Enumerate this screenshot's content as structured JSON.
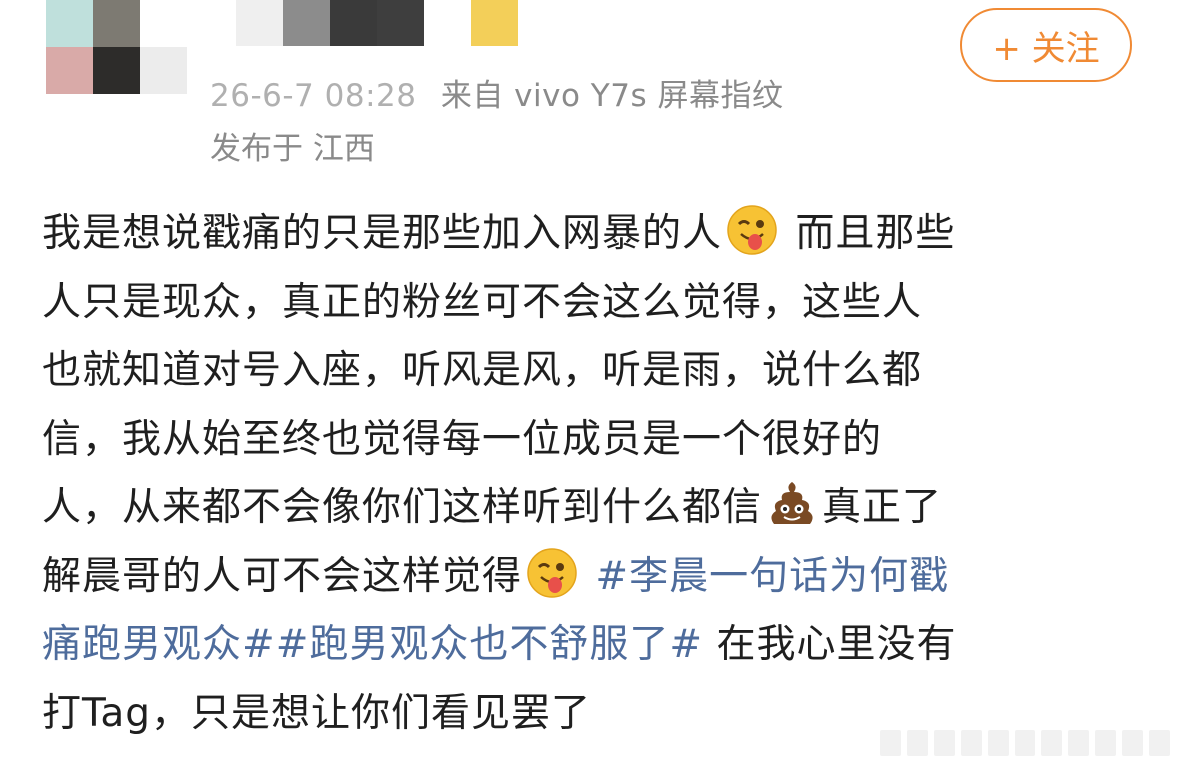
{
  "colors": {
    "follow_accent": "#f08a34",
    "hashtag": "#4e6c9c",
    "meta_text": "#8a8a8a",
    "body_text": "#1f1f1f"
  },
  "header": {
    "follow_label": "+ 关注",
    "date": "26-6-7 08:28",
    "source": "来自 vivo Y7s 屏幕指纹",
    "location": "发布于 江西"
  },
  "post": {
    "line1a": "我是想说戳痛的只是那些加入网暴的人",
    "line1b": "而且那些",
    "line2": "人只是现众，真正的粉丝可不会这么觉得，这些人",
    "line3": "也就知道对号入座，听风是风，听是雨，说什么都",
    "line4": "信，我从始至终也觉得每一位成员是一个很好的",
    "line5a": "人，从来都不会像你们这样听到什么都信",
    "line5b": "真正了",
    "line6a": "解晨哥的人可不会这样觉得",
    "hashtag1a": "#李晨一句话为何戳",
    "hashtag1b": "痛跑男观众#",
    "hashtag2": "#跑男观众也不舒服了#",
    "line7b": "在我心里没有",
    "line8": "打Tag，只是想让你们看见罢了"
  },
  "icons": {
    "emoji_1": "tongue-wink-emoji-icon",
    "emoji_2": "poop-emoji-icon",
    "emoji_3": "tongue-wink-emoji-icon"
  }
}
